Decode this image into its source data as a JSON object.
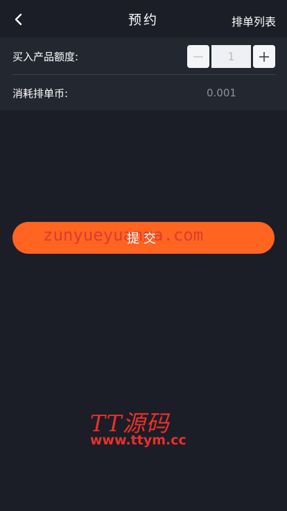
{
  "header": {
    "title": "预约",
    "right_link": "排单列表",
    "back_icon": "chevron-left-icon"
  },
  "form": {
    "amount_label": "买入产品额度:",
    "quantity_value": "1",
    "minus_icon": "minus-icon",
    "plus_icon": "plus-icon",
    "consume_label": "消耗排单币:",
    "consume_value": "0.001"
  },
  "submit": {
    "label": "提交"
  },
  "watermark": {
    "overlay_text": "zunyueyuanma.com",
    "logo_text": "TT源码",
    "logo_url": "www.ttym.cc"
  },
  "colors": {
    "background": "#1b1e26",
    "card": "#222730",
    "accent": "#ff6421",
    "watermark": "#e9302c"
  }
}
